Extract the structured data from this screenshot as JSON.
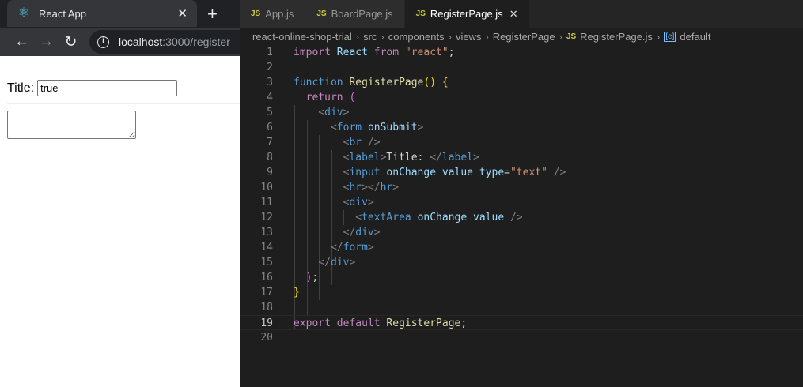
{
  "browser": {
    "tab_title": "React App",
    "url_host": "localhost",
    "url_path": ":3000/register",
    "title_label": "Title:",
    "title_value": "true",
    "textarea_value": ""
  },
  "editor": {
    "tabs": [
      {
        "label": "App.js",
        "icon": "JS"
      },
      {
        "label": "BoardPage.js",
        "icon": "JS"
      },
      {
        "label": "RegisterPage.js",
        "icon": "JS",
        "active": true
      }
    ],
    "breadcrumb": [
      "react-online-shop-trial",
      "src",
      "components",
      "views",
      "RegisterPage",
      "RegisterPage.js",
      "default"
    ],
    "current_line": 19,
    "lines": [
      [
        [
          "import",
          "kw"
        ],
        [
          " ",
          "tx"
        ],
        [
          "React",
          "vr"
        ],
        [
          " ",
          "tx"
        ],
        [
          "from",
          "kw"
        ],
        [
          " ",
          "tx"
        ],
        [
          "\"react\"",
          "st"
        ],
        [
          ";",
          "tx"
        ]
      ],
      [],
      [
        [
          "function",
          "fn"
        ],
        [
          " ",
          "tx"
        ],
        [
          "RegisterPage",
          "nm"
        ],
        [
          "()",
          "y"
        ],
        [
          " ",
          "tx"
        ],
        [
          "{",
          "y"
        ]
      ],
      [
        [
          "  ",
          "tx"
        ],
        [
          "return",
          "kw"
        ],
        [
          " ",
          "tx"
        ],
        [
          "(",
          "p"
        ]
      ],
      [
        [
          "    ",
          "tx"
        ],
        [
          "<",
          "br"
        ],
        [
          "div",
          "tg"
        ],
        [
          ">",
          "br"
        ]
      ],
      [
        [
          "      ",
          "tx"
        ],
        [
          "<",
          "br"
        ],
        [
          "form",
          "tg"
        ],
        [
          " ",
          "tx"
        ],
        [
          "onSubmit",
          "vr"
        ],
        [
          ">",
          "br"
        ]
      ],
      [
        [
          "        ",
          "tx"
        ],
        [
          "<",
          "br"
        ],
        [
          "br",
          "tg"
        ],
        [
          " />",
          "br"
        ]
      ],
      [
        [
          "        ",
          "tx"
        ],
        [
          "<",
          "br"
        ],
        [
          "label",
          "tg"
        ],
        [
          ">",
          "br"
        ],
        [
          "Title: ",
          "tx"
        ],
        [
          "</",
          "br"
        ],
        [
          "label",
          "tg"
        ],
        [
          ">",
          "br"
        ]
      ],
      [
        [
          "        ",
          "tx"
        ],
        [
          "<",
          "br"
        ],
        [
          "input",
          "tg"
        ],
        [
          " ",
          "tx"
        ],
        [
          "onChange",
          "vr"
        ],
        [
          " ",
          "tx"
        ],
        [
          "value",
          "vr"
        ],
        [
          " ",
          "tx"
        ],
        [
          "type",
          "vr"
        ],
        [
          "=",
          "tx"
        ],
        [
          "\"text\"",
          "st"
        ],
        [
          " />",
          "br"
        ]
      ],
      [
        [
          "        ",
          "tx"
        ],
        [
          "<",
          "br"
        ],
        [
          "hr",
          "tg"
        ],
        [
          "></",
          "br"
        ],
        [
          "hr",
          "tg"
        ],
        [
          ">",
          "br"
        ]
      ],
      [
        [
          "        ",
          "tx"
        ],
        [
          "<",
          "br"
        ],
        [
          "div",
          "tg"
        ],
        [
          ">",
          "br"
        ]
      ],
      [
        [
          "          ",
          "tx"
        ],
        [
          "<",
          "br"
        ],
        [
          "textArea",
          "tg"
        ],
        [
          " ",
          "tx"
        ],
        [
          "onChange",
          "vr"
        ],
        [
          " ",
          "tx"
        ],
        [
          "value",
          "vr"
        ],
        [
          " />",
          "br"
        ]
      ],
      [
        [
          "        ",
          "tx"
        ],
        [
          "</",
          "br"
        ],
        [
          "div",
          "tg"
        ],
        [
          ">",
          "br"
        ]
      ],
      [
        [
          "      ",
          "tx"
        ],
        [
          "</",
          "br"
        ],
        [
          "form",
          "tg"
        ],
        [
          ">",
          "br"
        ]
      ],
      [
        [
          "    ",
          "tx"
        ],
        [
          "</",
          "br"
        ],
        [
          "div",
          "tg"
        ],
        [
          ">",
          "br"
        ]
      ],
      [
        [
          "  ",
          "tx"
        ],
        [
          ")",
          "p"
        ],
        [
          ";",
          "tx"
        ]
      ],
      [
        [
          "}",
          "y"
        ]
      ],
      [],
      [
        [
          "export",
          "kw"
        ],
        [
          " ",
          "tx"
        ],
        [
          "default",
          "kw"
        ],
        [
          " ",
          "tx"
        ],
        [
          "RegisterPage",
          "nm"
        ],
        [
          ";",
          "tx"
        ]
      ],
      []
    ]
  }
}
